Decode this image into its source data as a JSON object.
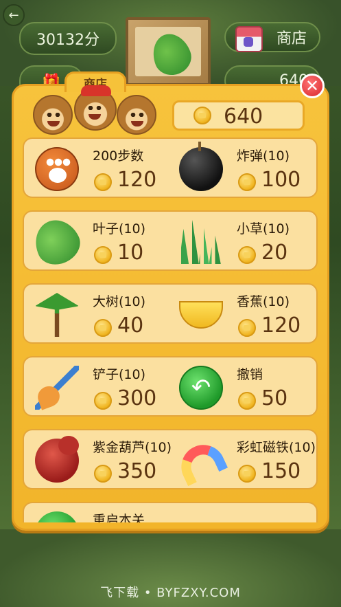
{
  "hud": {
    "score": "30132分",
    "shop_label": "商店",
    "coin_amount_bg": "640"
  },
  "panel": {
    "tab_label": "商店",
    "close_symbol": "✕",
    "coins": "640"
  },
  "items": [
    {
      "name": "200步数",
      "price": "120",
      "icon": "paw-icon"
    },
    {
      "name": "炸弹(10)",
      "price": "100",
      "icon": "bomb-icon"
    },
    {
      "name": "叶子(10)",
      "price": "10",
      "icon": "leaf-icon"
    },
    {
      "name": "小草(10)",
      "price": "20",
      "icon": "grass-icon"
    },
    {
      "name": "大树(10)",
      "price": "40",
      "icon": "tree-icon"
    },
    {
      "name": "香蕉(10)",
      "price": "120",
      "icon": "banana-icon"
    },
    {
      "name": "铲子(10)",
      "price": "300",
      "icon": "shovel-icon"
    },
    {
      "name": "撤销",
      "price": "50",
      "icon": "undo-icon"
    },
    {
      "name": "紫金葫芦(10)",
      "price": "350",
      "icon": "gourd-icon"
    },
    {
      "name": "彩虹磁铁(10)",
      "price": "150",
      "icon": "rainbow-magnet-icon"
    },
    {
      "name": "重启本关",
      "price": "",
      "icon": "restart-icon"
    }
  ],
  "watermark": "飞下载 • BYFZXY.COM"
}
